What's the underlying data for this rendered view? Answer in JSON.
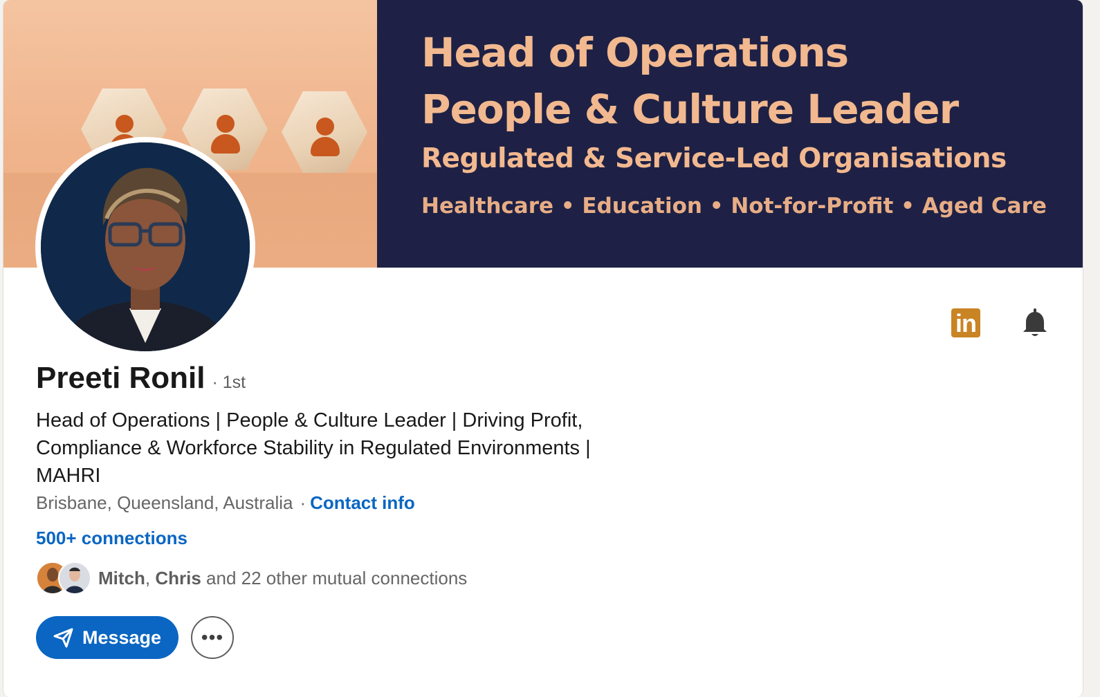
{
  "banner": {
    "line1": "Head of Operations",
    "line2": "People & Culture Leader",
    "line3": "Regulated & Service-Led Organisations",
    "line4": "Healthcare • Education • Not-for-Profit • Aged Care",
    "bg_color": "#1e2145",
    "text_color": "#f2b88f"
  },
  "profile": {
    "name": "Preeti Ronil",
    "degree": "· 1st",
    "headline": "Head of Operations | People & Culture Leader | Driving Profit, Compliance & Workforce Stability in Regulated Environments | MAHRI",
    "location": "Brisbane, Queensland, Australia",
    "separator": "·",
    "contact_label": "Contact info",
    "connections": "500+ connections"
  },
  "mutual": {
    "name1": "Mitch",
    "comma": ", ",
    "name2": "Chris",
    "rest": " and 22 other mutual connections"
  },
  "actions": {
    "message_label": "Message",
    "more_label": "•••"
  },
  "icons": {
    "linkedin_text": "in",
    "linkedin_color": "#c98424",
    "bell": "bell-icon"
  },
  "colors": {
    "accent": "#0a66c2"
  }
}
